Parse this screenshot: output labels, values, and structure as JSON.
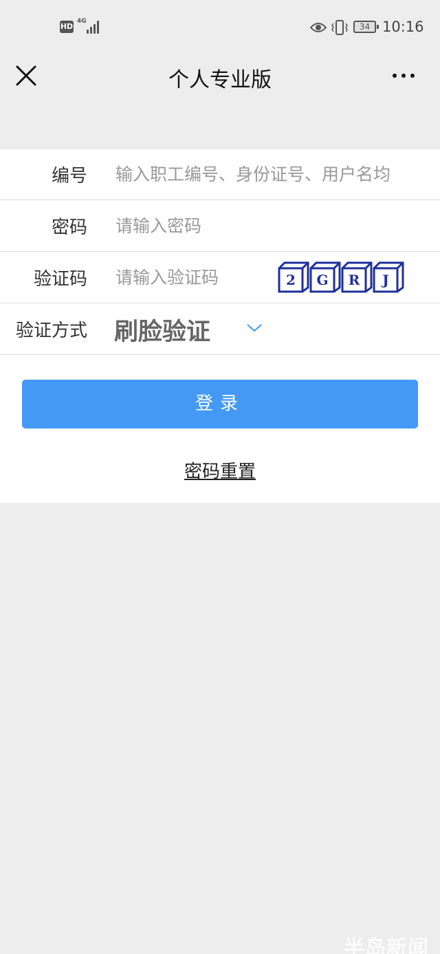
{
  "status_bar": {
    "hd_badge": "HD",
    "network": "4G",
    "battery_level": "34",
    "time": "10:16",
    "icons": [
      "signal-icon",
      "eye-icon",
      "vibrate-icon",
      "battery-icon"
    ]
  },
  "nav": {
    "title": "个人专业版",
    "close_icon": "close-icon",
    "more_icon": "more-icon"
  },
  "form": {
    "id_label": "编号",
    "id_placeholder": "输入职工编号、身份证号、用户名均",
    "password_label": "密码",
    "password_placeholder": "请输入密码",
    "captcha_label": "验证码",
    "captcha_placeholder": "请输入验证码",
    "captcha_chars": [
      "2",
      "G",
      "R",
      "J"
    ],
    "method_label": "验证方式",
    "method_value": "刷脸验证",
    "login_button": "登录",
    "reset_link": "密码重置"
  },
  "colors": {
    "accent": "#4499f5",
    "page_background": "#ededed",
    "card_background": "#ffffff",
    "captcha_blue": "#1f2f9c"
  },
  "watermark": "半岛新闻"
}
